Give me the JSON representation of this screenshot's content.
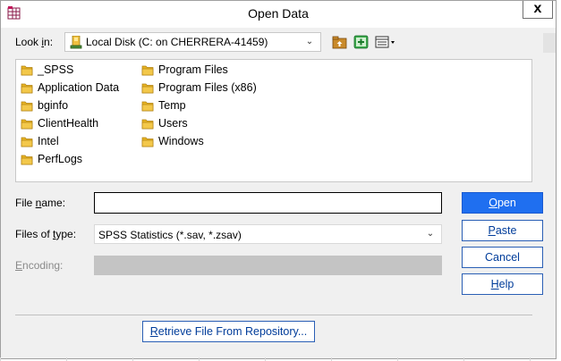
{
  "window": {
    "title": "Open Data",
    "close_glyph": "x"
  },
  "look_in": {
    "label_prefix": "Look ",
    "label_accel": "i",
    "label_suffix": "n:",
    "value": "Local Disk (C: on CHERRERA-41459)",
    "icon": "local-disk-icon"
  },
  "toolbar": {
    "icons": [
      "up-folder-icon",
      "new-folder-icon",
      "view-menu-icon"
    ]
  },
  "files": {
    "column1": [
      "_SPSS",
      "Application Data",
      "bginfo",
      "ClientHealth",
      "Intel",
      "PerfLogs"
    ],
    "column2": [
      "Program Files",
      "Program Files (x86)",
      "Temp",
      "Users",
      "Windows"
    ]
  },
  "file_name": {
    "label_prefix": "File ",
    "label_accel": "n",
    "label_suffix": "ame:",
    "value": ""
  },
  "files_of_type": {
    "label_prefix": "Files of ",
    "label_accel": "t",
    "label_suffix": "ype:",
    "value": "SPSS Statistics (*.sav, *.zsav)"
  },
  "encoding": {
    "label_accel": "E",
    "label_suffix": "ncoding:",
    "value": ""
  },
  "buttons": {
    "open": {
      "accel": "O",
      "rest": "pen"
    },
    "paste": {
      "accel": "P",
      "rest": "aste"
    },
    "cancel": {
      "label": "Cancel"
    },
    "help": {
      "accel": "H",
      "rest": "elp"
    },
    "repository": {
      "accel": "R",
      "rest": "etrieve File From Repository..."
    }
  },
  "colors": {
    "primary_button": "#1f6ff0",
    "folder": "#e8b422",
    "button_text": "#003c9a"
  }
}
